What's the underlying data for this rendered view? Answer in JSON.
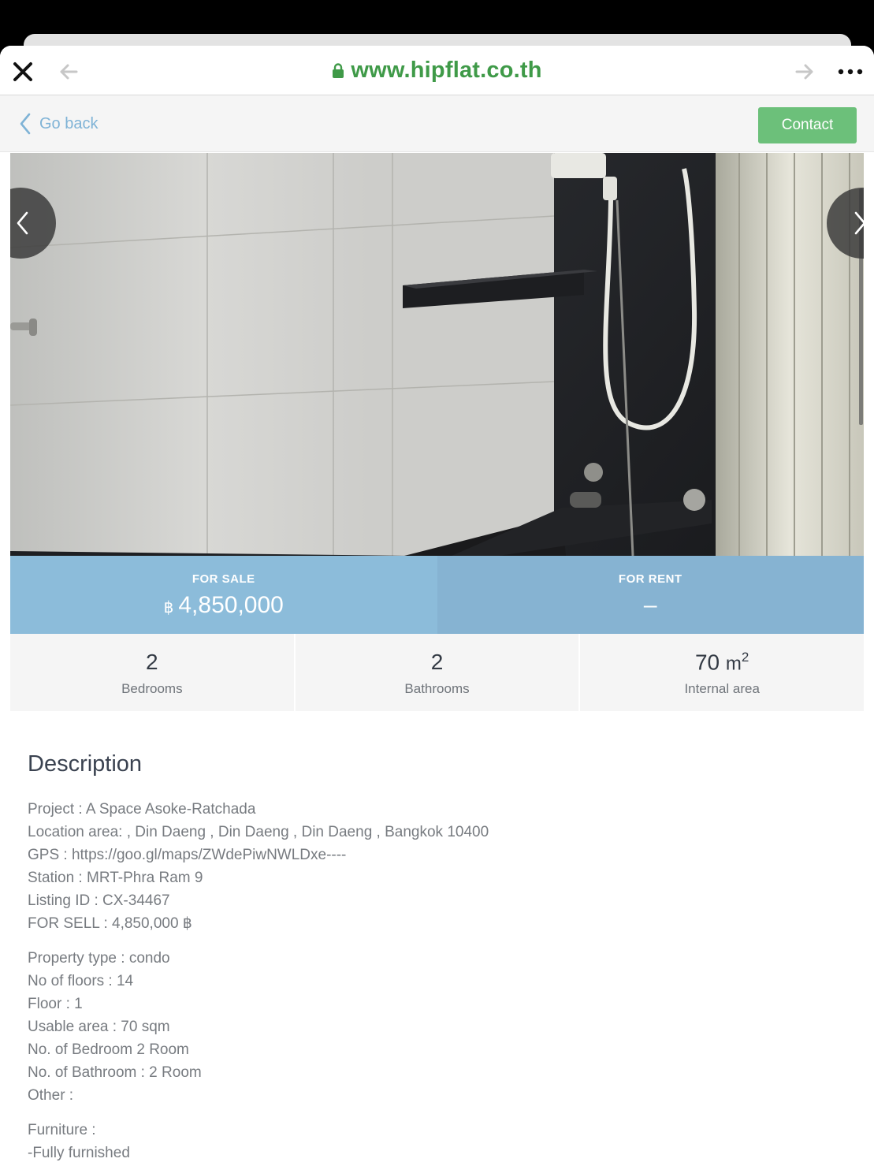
{
  "browser": {
    "url": "www.hipflat.co.th"
  },
  "header": {
    "go_back": "Go back",
    "contact": "Contact"
  },
  "price": {
    "sale_label": "FOR SALE",
    "sale_currency": "฿",
    "sale_value": "4,850,000",
    "rent_label": "FOR RENT",
    "rent_value": "–"
  },
  "stats": [
    {
      "value": "2",
      "label": "Bedrooms"
    },
    {
      "value": "2",
      "label": "Bathrooms"
    },
    {
      "value": "70",
      "unit": "m",
      "unit_sup": "2",
      "label": "Internal area"
    }
  ],
  "description": {
    "title": "Description",
    "group1": [
      "Project : A Space Asoke-Ratchada",
      "Location area: , Din Daeng , Din Daeng , Din Daeng , Bangkok 10400",
      "GPS : https://goo.gl/maps/ZWdePiwNWLDxe----",
      "Station : MRT-Phra Ram 9",
      "Listing ID : CX-34467",
      "FOR SELL : 4,850,000 ฿"
    ],
    "group2": [
      "Property type : condo",
      "No of floors : 14",
      "Floor : 1",
      "Usable area : 70 sqm",
      "No. of Bedroom 2 Room",
      "No. of Bathroom : 2 Room",
      "Other :"
    ],
    "group3": [
      "Furniture :",
      "-Fully furnished"
    ]
  },
  "colors": {
    "url_green": "#3f9a48",
    "contact_green": "#6cc07a",
    "price_blue": "#8cbcda",
    "link_blue": "#7fb3d6"
  }
}
